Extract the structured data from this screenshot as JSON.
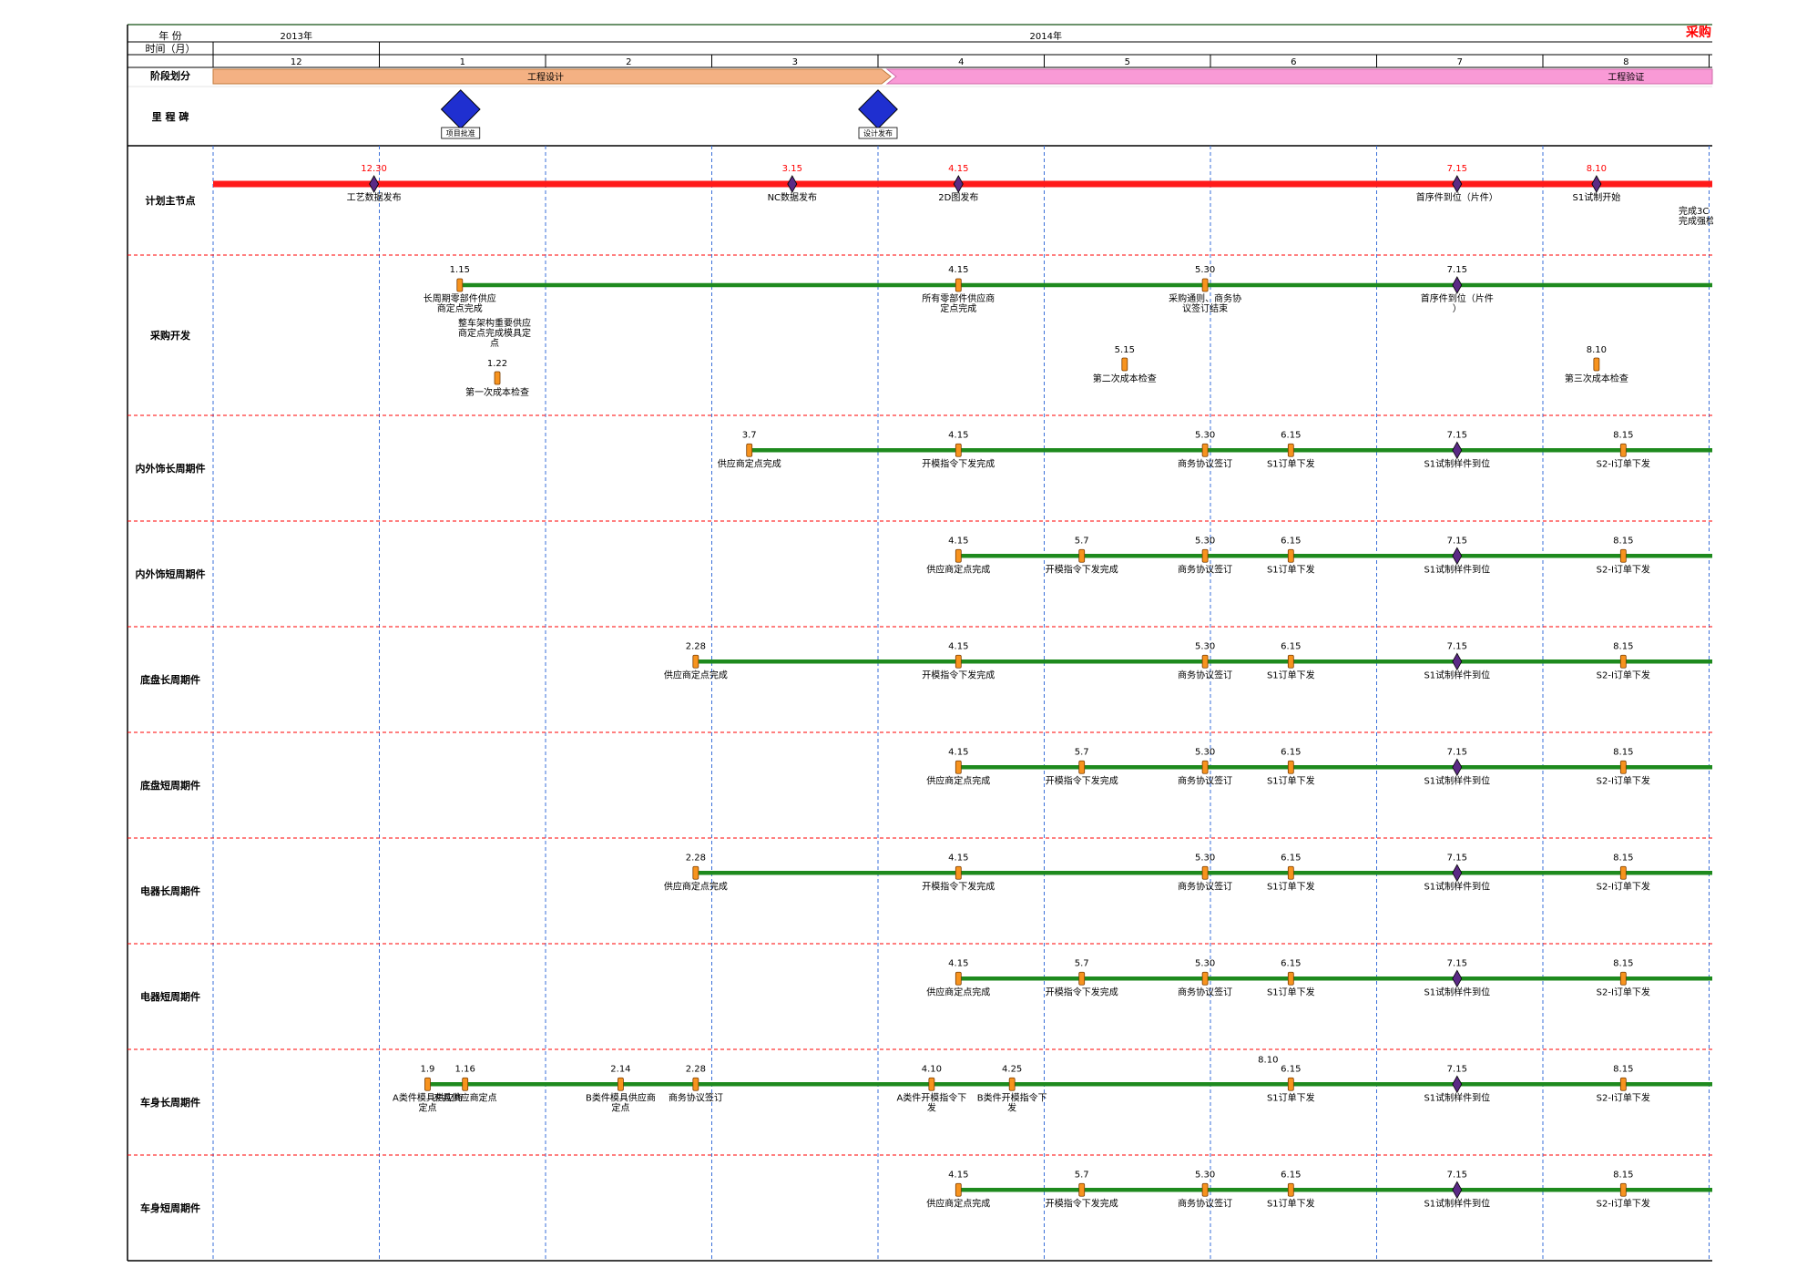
{
  "corner_title": "采购",
  "header": {
    "year_label": "年    份",
    "time_label": "时间（月）",
    "phase_label": "阶段划分",
    "years": [
      {
        "label": "2013年",
        "months": [
          "12"
        ]
      },
      {
        "label": "2014年",
        "months": [
          "1",
          "2",
          "3",
          "4",
          "5",
          "6",
          "7",
          "8"
        ]
      }
    ],
    "phases": [
      {
        "label": "工程设计",
        "color": "#f4b183"
      },
      {
        "label": "工程验证",
        "color": "#f99ad6"
      }
    ]
  },
  "colors": {
    "plan_line": "#ff1a1a",
    "track_line": "#1e8a1e",
    "marker_fill": "#f7931e",
    "diamond_fill": "#5b2a86",
    "milestone_fill": "#1f2fd0",
    "row_divider": "#ff0000",
    "month_divider": "#3a6fd8",
    "date_red": "#ff0000"
  },
  "milestones": {
    "label": "里 程 碑",
    "items": [
      {
        "date": "1月",
        "caption": "项目批准"
      },
      {
        "date": "4月",
        "caption": "设计发布"
      }
    ]
  },
  "rows": [
    {
      "label": "计划主节点",
      "events": [
        {
          "date": "12.30",
          "label": "工艺数据发布",
          "shape": "diamond"
        },
        {
          "date": "3.15",
          "label": "NC数据发布",
          "shape": "diamond"
        },
        {
          "date": "4.15",
          "label": "2D图发布",
          "shape": "diamond"
        },
        {
          "date": "7.15",
          "label": "首序件到位（片件）",
          "shape": "diamond"
        },
        {
          "date": "8.10",
          "label": "S1试制开始",
          "shape": "diamond"
        }
      ],
      "trailing_note": [
        "完成3C",
        "完成强检"
      ]
    },
    {
      "label": "采购开发",
      "events": [
        {
          "date": "1.15",
          "label": "长周期零部件供应商定点完成",
          "shape": "bar"
        },
        {
          "date": "4.15",
          "label": "所有零部件供应商定点完成",
          "shape": "bar"
        },
        {
          "date": "5.30",
          "label": "采购通则、商务协议签订结束",
          "shape": "bar"
        },
        {
          "date": "7.15",
          "label": "首序件到位（片件）",
          "shape": "diamond"
        }
      ],
      "extras": [
        {
          "date": "1.22",
          "label": "第一次成本检查",
          "note": "整车架构重要供应商定点完成 模具定点"
        },
        {
          "date": "5.15",
          "label": "第二次成本检查"
        },
        {
          "date": "8.10",
          "label": "第三次成本检查"
        }
      ]
    },
    {
      "label": "内外饰长周期件",
      "events": [
        {
          "date": "3.7",
          "label": "供应商定点完成",
          "shape": "bar"
        },
        {
          "date": "4.15",
          "label": "开模指令下发完成",
          "shape": "bar"
        },
        {
          "date": "5.30",
          "label": "商务协议签订",
          "shape": "bar"
        },
        {
          "date": "6.15",
          "label": "S1订单下发",
          "shape": "bar"
        },
        {
          "date": "7.15",
          "label": "S1试制样件到位",
          "shape": "diamond"
        },
        {
          "date": "8.15",
          "label": "S2-I订单下发",
          "shape": "bar"
        }
      ]
    },
    {
      "label": "内外饰短周期件",
      "events": [
        {
          "date": "4.15",
          "label": "供应商定点完成",
          "shape": "bar"
        },
        {
          "date": "5.7",
          "label": "开模指令下发完成",
          "shape": "bar"
        },
        {
          "date": "5.30",
          "label": "商务协议签订",
          "shape": "bar"
        },
        {
          "date": "6.15",
          "label": "S1订单下发",
          "shape": "bar"
        },
        {
          "date": "7.15",
          "label": "S1试制样件到位",
          "shape": "diamond"
        },
        {
          "date": "8.15",
          "label": "S2-I订单下发",
          "shape": "bar"
        }
      ]
    },
    {
      "label": "底盘长周期件",
      "events": [
        {
          "date": "2.28",
          "label": "供应商定点完成",
          "shape": "bar"
        },
        {
          "date": "4.15",
          "label": "开模指令下发完成",
          "shape": "bar"
        },
        {
          "date": "5.30",
          "label": "商务协议签订",
          "shape": "bar"
        },
        {
          "date": "6.15",
          "label": "S1订单下发",
          "shape": "bar"
        },
        {
          "date": "7.15",
          "label": "S1试制样件到位",
          "shape": "diamond"
        },
        {
          "date": "8.15",
          "label": "S2-I订单下发",
          "shape": "bar"
        }
      ]
    },
    {
      "label": "底盘短周期件",
      "events": [
        {
          "date": "4.15",
          "label": "供应商定点完成",
          "shape": "bar"
        },
        {
          "date": "5.7",
          "label": "开模指令下发完成",
          "shape": "bar"
        },
        {
          "date": "5.30",
          "label": "商务协议签订",
          "shape": "bar"
        },
        {
          "date": "6.15",
          "label": "S1订单下发",
          "shape": "bar"
        },
        {
          "date": "7.15",
          "label": "S1试制样件到位",
          "shape": "diamond"
        },
        {
          "date": "8.15",
          "label": "S2-I订单下发",
          "shape": "bar"
        }
      ]
    },
    {
      "label": "电器长周期件",
      "events": [
        {
          "date": "2.28",
          "label": "供应商定点完成",
          "shape": "bar"
        },
        {
          "date": "4.15",
          "label": "开模指令下发完成",
          "shape": "bar"
        },
        {
          "date": "5.30",
          "label": "商务协议签订",
          "shape": "bar"
        },
        {
          "date": "6.15",
          "label": "S1订单下发",
          "shape": "bar"
        },
        {
          "date": "7.15",
          "label": "S1试制样件到位",
          "shape": "diamond"
        },
        {
          "date": "8.15",
          "label": "S2-I订单下发",
          "shape": "bar"
        }
      ]
    },
    {
      "label": "电器短周期件",
      "events": [
        {
          "date": "4.15",
          "label": "供应商定点完成",
          "shape": "bar"
        },
        {
          "date": "5.7",
          "label": "开模指令下发完成",
          "shape": "bar"
        },
        {
          "date": "5.30",
          "label": "商务协议签订",
          "shape": "bar"
        },
        {
          "date": "6.15",
          "label": "S1订单下发",
          "shape": "bar"
        },
        {
          "date": "7.15",
          "label": "S1试制样件到位",
          "shape": "diamond"
        },
        {
          "date": "8.15",
          "label": "S2-I订单下发",
          "shape": "bar"
        }
      ]
    },
    {
      "label": "车身长周期件",
      "events": [
        {
          "date": "1.9",
          "label": "A类件模具供应商定点",
          "shape": "bar"
        },
        {
          "date": "1.16",
          "label": "夹具供应商定点",
          "shape": "bar"
        },
        {
          "date": "2.14",
          "label": "B类件模具供应商定点",
          "shape": "bar"
        },
        {
          "date": "2.28",
          "label": "商务协议签订",
          "shape": "bar"
        },
        {
          "date": "4.10",
          "label": "A类件开模指令下发",
          "shape": "bar"
        },
        {
          "date": "4.25",
          "label": "B类件开模指令下发",
          "shape": "bar"
        },
        {
          "date": "6.15",
          "label": "S1订单下发",
          "shape": "bar",
          "extra_date": "8.10"
        },
        {
          "date": "7.15",
          "label": "S1试制样件到位",
          "shape": "diamond"
        },
        {
          "date": "8.15",
          "label": "S2-I订单下发",
          "shape": "bar"
        }
      ]
    },
    {
      "label": "车身短周期件",
      "events": [
        {
          "date": "4.15",
          "label": "供应商定点完成",
          "shape": "bar"
        },
        {
          "date": "5.7",
          "label": "开模指令下发完成",
          "shape": "bar"
        },
        {
          "date": "5.30",
          "label": "商务协议签订",
          "shape": "bar"
        },
        {
          "date": "6.15",
          "label": "S1订单下发",
          "shape": "bar"
        },
        {
          "date": "7.15",
          "label": "S1试制样件到位",
          "shape": "diamond"
        },
        {
          "date": "8.15",
          "label": "S2-I订单下发",
          "shape": "bar"
        }
      ]
    }
  ],
  "chart_data": {
    "type": "table",
    "x_axis": "time (month)",
    "months": [
      "2013-12",
      "2014-01",
      "2014-02",
      "2014-03",
      "2014-04",
      "2014-05",
      "2014-06",
      "2014-07",
      "2014-08"
    ],
    "grid": true
  }
}
